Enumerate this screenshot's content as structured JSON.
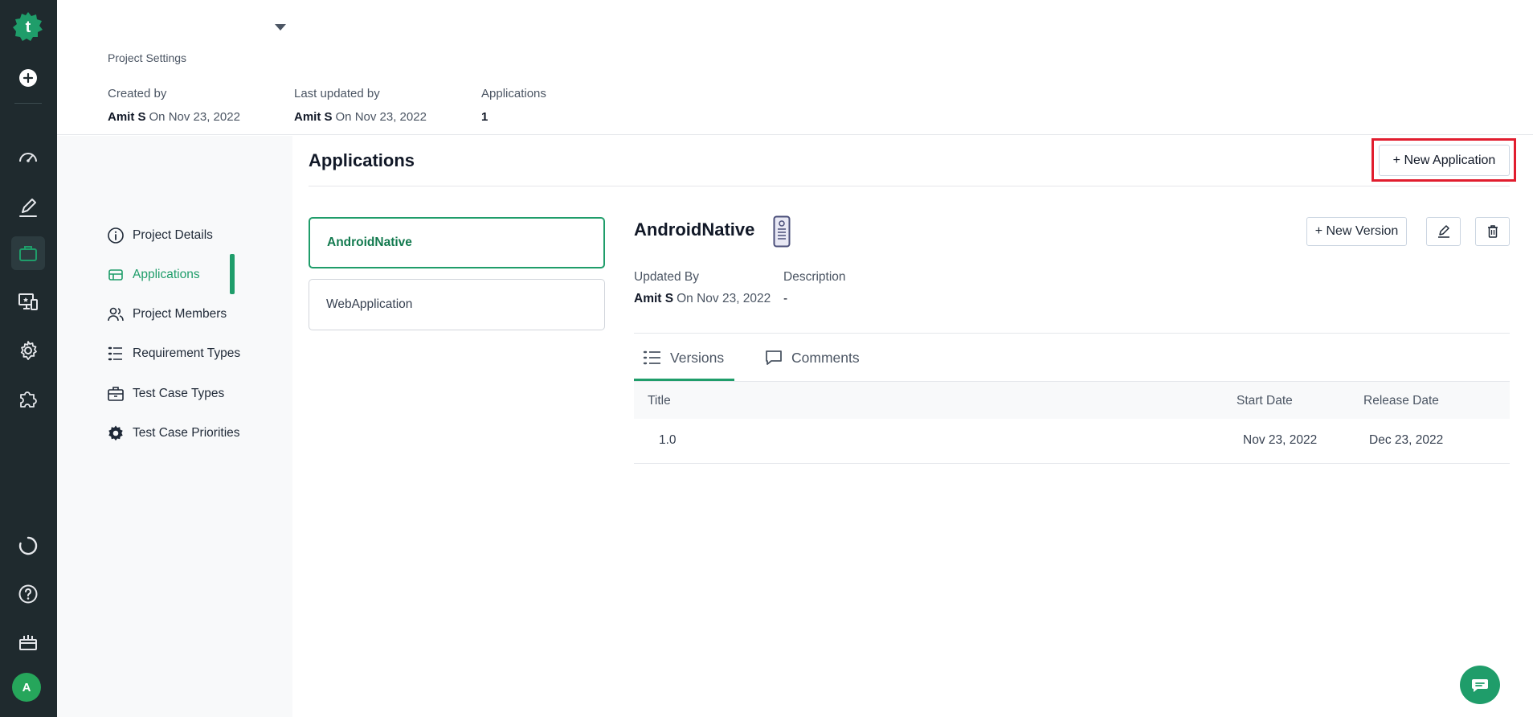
{
  "rail": {
    "brand_letter": "t",
    "avatar_initial": "A",
    "accent": "#1f9d6a",
    "background": "#1f2a2e"
  },
  "header": {
    "breadcrumb": "Project Settings",
    "created": {
      "label": "Created by",
      "user": "Amit S",
      "date": "On Nov 23, 2022"
    },
    "updated": {
      "label": "Last updated by",
      "user": "Amit S",
      "date": "On Nov 23, 2022"
    },
    "applications": {
      "label": "Applications",
      "count": "1"
    }
  },
  "settings_nav": {
    "items": [
      {
        "label": "Project Details",
        "icon": "info-icon"
      },
      {
        "label": "Applications",
        "icon": "applications-icon"
      },
      {
        "label": "Project Members",
        "icon": "members-icon"
      },
      {
        "label": "Requirement Types",
        "icon": "list-icon"
      },
      {
        "label": "Test Case Types",
        "icon": "briefcase-icon"
      },
      {
        "label": "Test Case Priorities",
        "icon": "gear-icon"
      }
    ]
  },
  "main": {
    "title": "Applications",
    "new_app_label": "+ New Application",
    "apps": [
      {
        "name": "AndroidNative"
      },
      {
        "name": "WebApplication"
      }
    ]
  },
  "detail": {
    "name": "AndroidNative",
    "new_version_label": "+ New Version",
    "updated_label": "Updated By",
    "updated_user": "Amit S",
    "updated_date": "On Nov 23, 2022",
    "description_label": "Description",
    "description_value": "-",
    "tabs": [
      {
        "label": "Versions",
        "icon": "list-icon"
      },
      {
        "label": "Comments",
        "icon": "comment-icon"
      }
    ],
    "table": {
      "headers": {
        "title": "Title",
        "start": "Start Date",
        "release": "Release Date"
      },
      "rows": [
        {
          "title": "1.0",
          "start": "Nov 23, 2022",
          "release": "Dec 23, 2022"
        }
      ]
    }
  }
}
